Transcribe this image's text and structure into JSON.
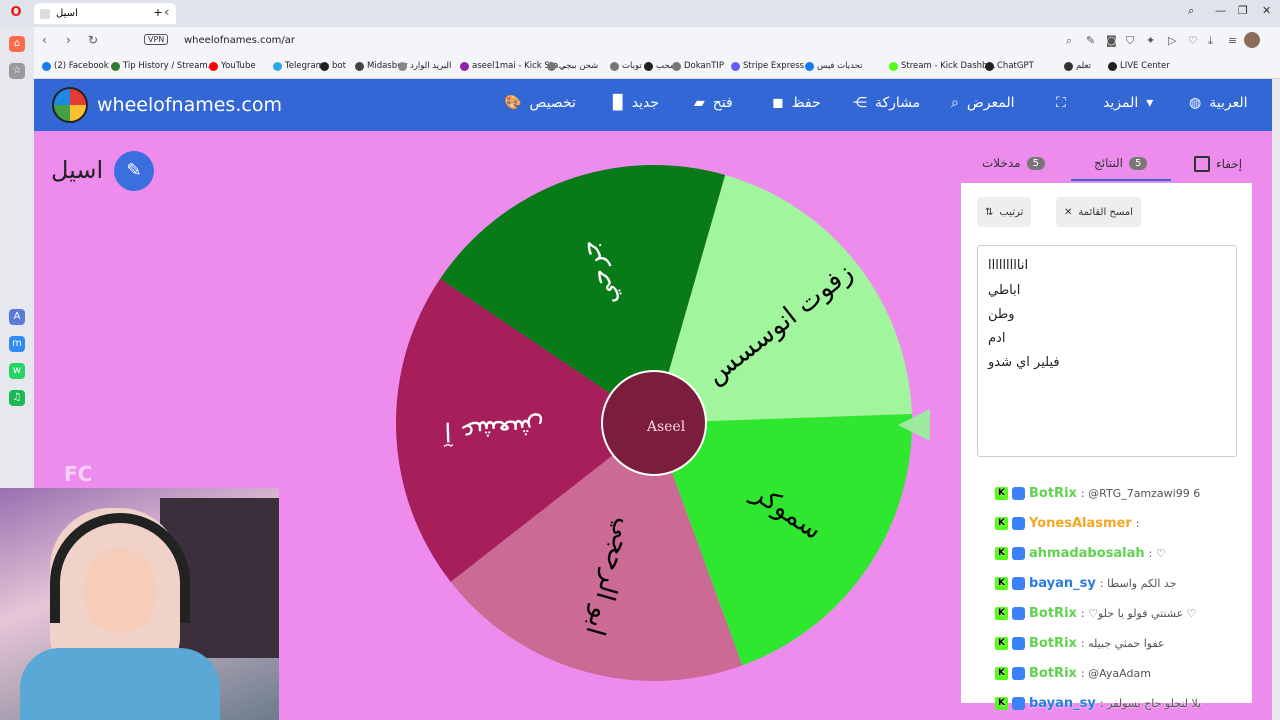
{
  "browser": {
    "tab_title": "اسيل",
    "url": "wheelofnames.com/ar",
    "vpn_label": "VPN",
    "bookmarks": [
      {
        "label": "(2) Facebook",
        "color": "#1877f2"
      },
      {
        "label": "Tip History / Stream...",
        "color": "#2e7d32"
      },
      {
        "label": "YouTube",
        "color": "#ff0000"
      },
      {
        "label": "Telegram",
        "color": "#29a9eb"
      },
      {
        "label": "bot",
        "color": "#222222"
      },
      {
        "label": "Midasbuy",
        "color": "#444444"
      },
      {
        "label": "البريد الوارد",
        "color": "#888888"
      },
      {
        "label": "aseel1mai - Kick Sta...",
        "color": "#8e24aa"
      },
      {
        "label": "شحن ببجي",
        "color": "#777777"
      },
      {
        "label": "توبات",
        "color": "#777777"
      },
      {
        "label": "سحب",
        "color": "#222222"
      },
      {
        "label": "DokanTIP",
        "color": "#777777"
      },
      {
        "label": "Stripe Express",
        "color": "#635bff"
      },
      {
        "label": "تحديات فيس",
        "color": "#1877f2"
      },
      {
        "label": "Stream - Kick Dashb...",
        "color": "#53fc18"
      },
      {
        "label": "ChatGPT",
        "color": "#222222"
      },
      {
        "label": "تعلم",
        "color": "#333333"
      },
      {
        "label": "LIVE Center",
        "color": "#222222"
      }
    ]
  },
  "header": {
    "site": "wheelofnames.com",
    "menu": {
      "customize": "تخصيص",
      "new": "جديد",
      "open": "فتح",
      "save": "حفظ",
      "share": "مشاركة",
      "gallery": "المعرض",
      "more": "المزيد",
      "language": "العربية"
    }
  },
  "wheel": {
    "name": "اسيل",
    "segments": [
      {
        "label": "زفوت انوسسس",
        "color": "#a1f59d"
      },
      {
        "label": "سموكر",
        "color": "#2fe72f"
      },
      {
        "label": "ابو الرحجي",
        "color": "#cc6a96"
      },
      {
        "label": "آ عشعش",
        "color": "#a61f5a"
      },
      {
        "label": "جرحي",
        "color": "#087a17"
      }
    ],
    "center_text": "Aseel"
  },
  "panel": {
    "tabs": {
      "entries_label": "مدخلات",
      "entries_count": "5",
      "results_label": "النتائج",
      "results_count": "5",
      "hide_label": "إخفاء"
    },
    "sort_label": "ترتيب",
    "clear_label": "امسح القائمة",
    "results": [
      "انااااااااا",
      "اباطي",
      "وطن",
      "ادم",
      "فيلير اي شدو"
    ]
  },
  "chat": [
    {
      "user": "BotRix",
      "color": "#5fd34f",
      "message": ": @RTG_7amzawi99 6"
    },
    {
      "user": "YonesAlasmer",
      "color": "#f5a623",
      "message": ":"
    },
    {
      "user": "ahmadabosalah",
      "color": "#5fd34f",
      "message": ": ♡"
    },
    {
      "user": "bayan_sy",
      "color": "#2a7de1",
      "message": ": جد الكم واسطا"
    },
    {
      "user": "BotRix",
      "color": "#5fd34f",
      "message": ": ♡عشنتي فولو يا حلو ♡"
    },
    {
      "user": "BotRix",
      "color": "#5fd34f",
      "message": ": عفوا حمثي جبيله"
    },
    {
      "user": "BotRix",
      "color": "#5fd34f",
      "message": ": @AyaAdam"
    },
    {
      "user": "bayan_sy",
      "color": "#2a7de1",
      "message": ": يلا لنحلو حاج نسولفر"
    }
  ],
  "overlay": {
    "fc_logo": "FC"
  }
}
